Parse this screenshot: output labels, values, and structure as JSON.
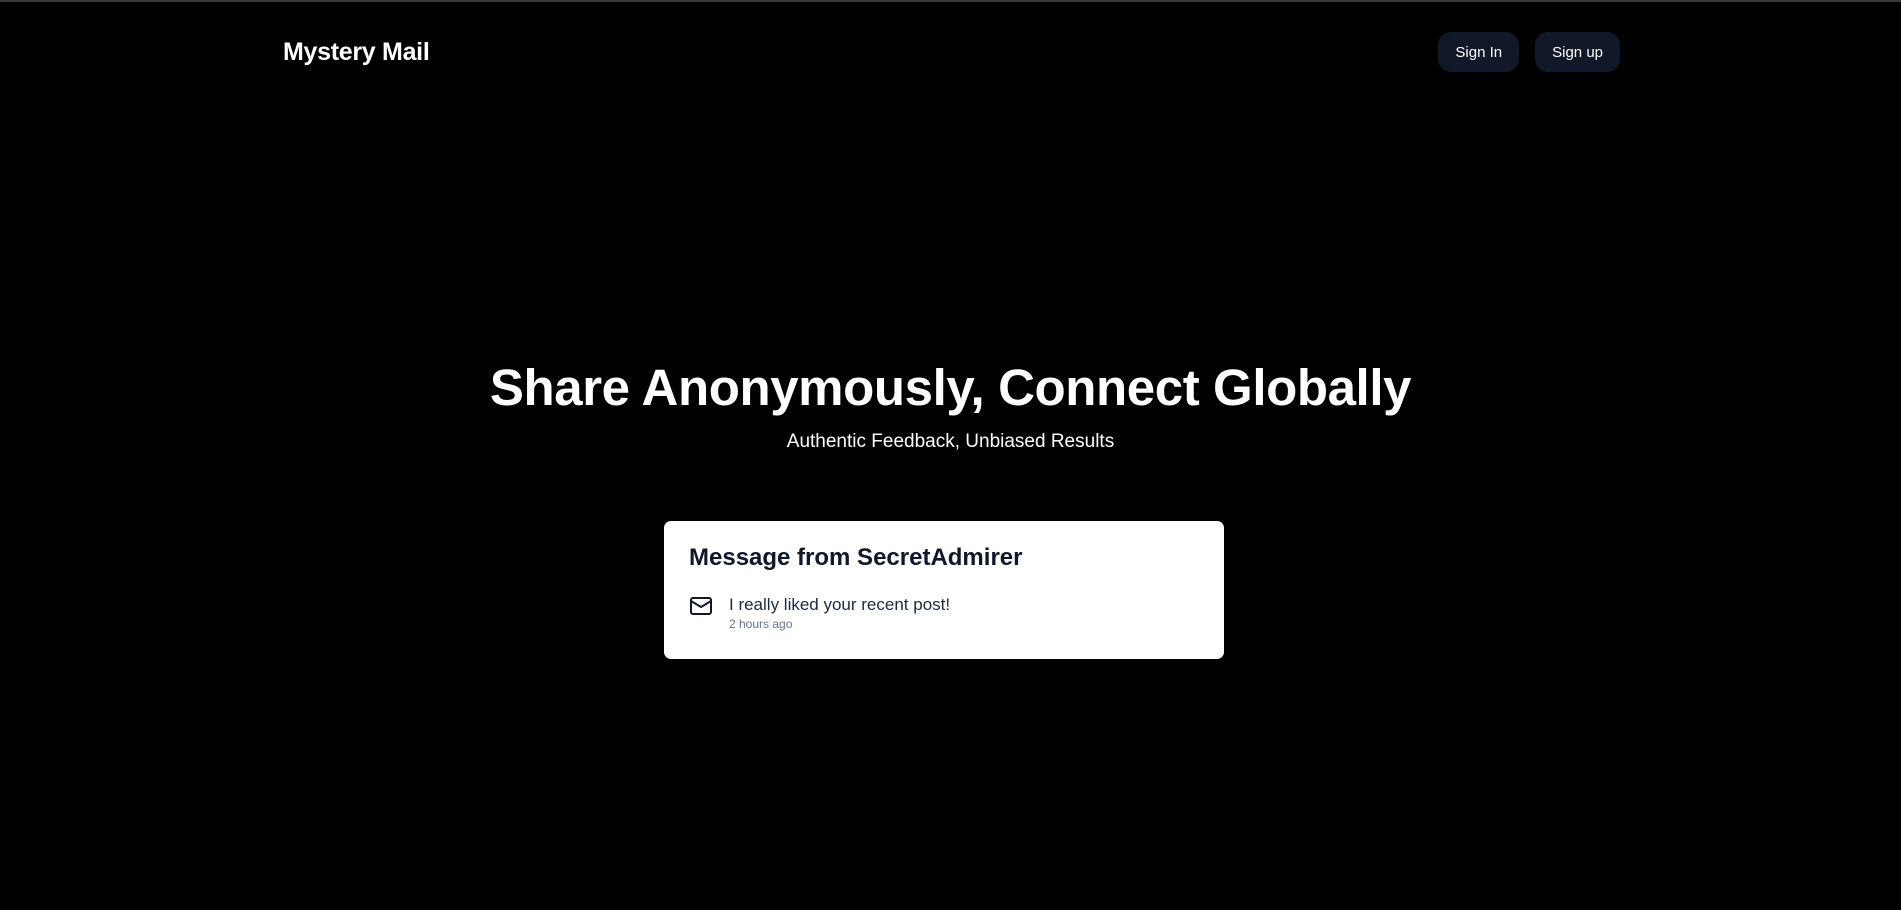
{
  "header": {
    "brand": "Mystery Mail",
    "sign_in_label": "Sign In",
    "sign_up_label": "Sign up"
  },
  "hero": {
    "title": "Share Anonymously, Connect Globally",
    "subtitle": "Authentic Feedback, Unbiased Results"
  },
  "message_card": {
    "title": "Message from SecretAdmirer",
    "icon": "mail-icon",
    "text": "I really liked your recent post!",
    "time": "2 hours ago"
  },
  "colors": {
    "background": "#000000",
    "button_bg": "#111827",
    "card_bg": "#ffffff",
    "muted_text": "#64748b"
  }
}
